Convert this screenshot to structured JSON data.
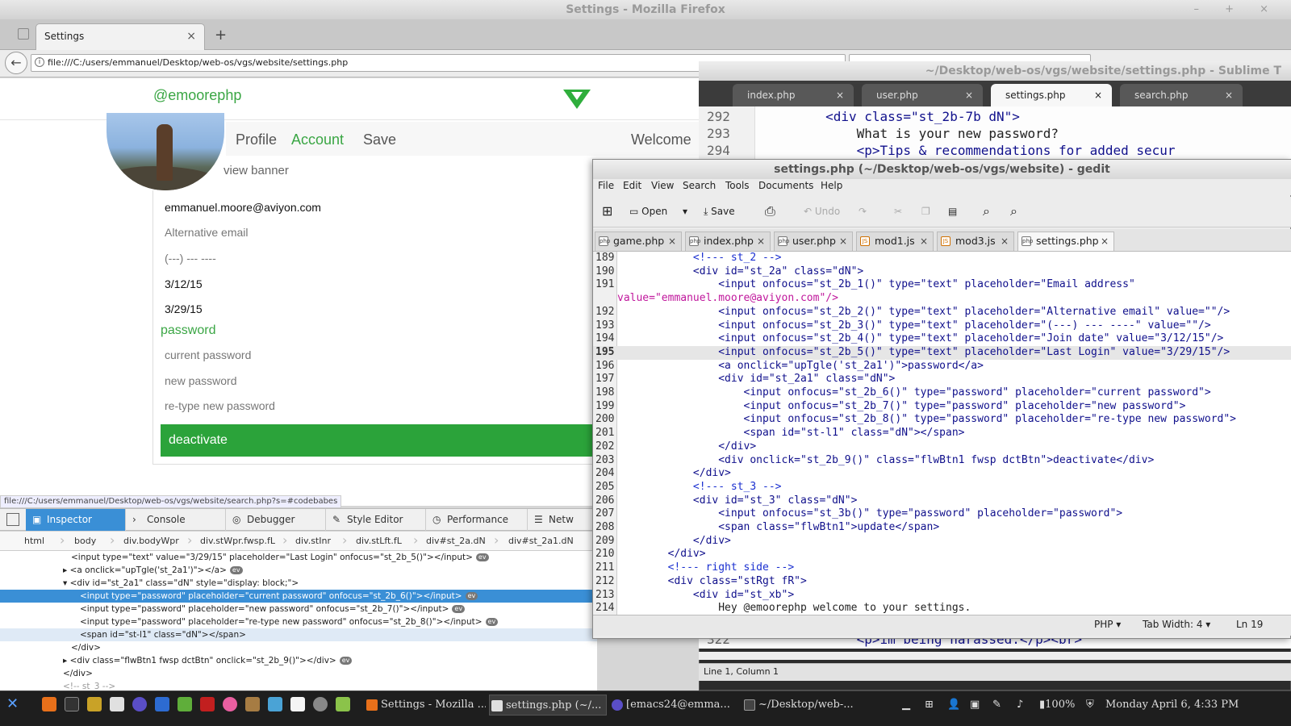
{
  "firefox": {
    "window_title": "Settings - Mozilla Firefox",
    "window_controls": "– + ×",
    "tab_label": "Settings",
    "tab_close": "×",
    "new_tab": "+",
    "back": "←",
    "url": "file:///C:/users/emmanuel/Desktop/web-os/vgs/website/settings.php",
    "status_url": "file:///C:/users/emmanuel/Desktop/web-os/vgs/website/search.php?s=#codebabes"
  },
  "site": {
    "handle": "@emoorephp",
    "brand_color": "#2fae3c",
    "nav": {
      "profile": "Profile",
      "account": "Account",
      "save": "Save",
      "welcome": "Welcome"
    },
    "view_banner": "view banner",
    "fields": {
      "email": "emmanuel.moore@aviyon.com",
      "alt_email": "Alternative email",
      "phone": "(---) --- ----",
      "join_date": "3/12/15",
      "last_login": "3/29/15"
    },
    "password_link": "password",
    "password_fields": {
      "current": "current password",
      "new": "new password",
      "retype": "re-type new password"
    },
    "deactivate": "deactivate"
  },
  "devtools": {
    "tabs": [
      "Inspector",
      "Console",
      "Debugger",
      "Style Editor",
      "Performance",
      "Netw"
    ],
    "breadcrumbs": [
      "html",
      "body",
      "div.bodyWpr",
      "div.stWpr.fwsp.fL",
      "div.stInr",
      "div.stLft.fL",
      "div#st_2a.dN",
      "div#st_2a1.dN"
    ],
    "ev_badge": "ev",
    "tree": [
      "<input type=\"text\" value=\"3/29/15\" placeholder=\"Last Login\" onfocus=\"st_2b_5()\"></input>",
      "<a onclick=\"upTgle('st_2a1')\"></a>",
      "<div id=\"st_2a1\" class=\"dN\" style=\"display: block;\">",
      "<input type=\"password\" placeholder=\"current password\" onfocus=\"st_2b_6()\"></input>",
      "<input type=\"password\" placeholder=\"new password\" onfocus=\"st_2b_7()\"></input>",
      "<input type=\"password\" placeholder=\"re-type new password\" onfocus=\"st_2b_8()\"></input>",
      "<span id=\"st-l1\" class=\"dN\"></span>",
      "</div>",
      "<div class=\"flwBtn1 fwsp dctBtn\" onclick=\"st_2b_9()\"></div>",
      "</div>",
      "<!-- st_3 -->"
    ]
  },
  "sublime": {
    "title": "~/Desktop/web-os/vgs/website/settings.php - Sublime T",
    "tabs": [
      "index.php",
      "user.php",
      "settings.php",
      "search.php"
    ],
    "active_tab": "settings.php",
    "tab_close": "×",
    "lines": [
      {
        "n": "292",
        "code": "        <div class=\"st_2b-7b dN\">"
      },
      {
        "n": "293",
        "code": "            What is your new password?"
      },
      {
        "n": "294",
        "code": "            <p>Tips & recommendations for added secur"
      }
    ],
    "lower_line": {
      "n": "322",
      "code": "            <p>im being harassed.</p><br>"
    },
    "status": "Line 1, Column 1"
  },
  "gedit": {
    "title": "settings.php (~/Desktop/web-os/vgs/website) - gedit",
    "menu": [
      "File",
      "Edit",
      "View",
      "Search",
      "Tools",
      "Documents",
      "Help"
    ],
    "toolbar": {
      "open": "Open",
      "save": "Save",
      "undo": "Undo"
    },
    "tabs": [
      {
        "label": "game.php",
        "type": "php"
      },
      {
        "label": "index.php",
        "type": "php"
      },
      {
        "label": "user.php",
        "type": "php"
      },
      {
        "label": "mod1.js",
        "type": "js"
      },
      {
        "label": "mod3.js",
        "type": "js"
      },
      {
        "label": "settings.php",
        "type": "php"
      }
    ],
    "tab_close": "×",
    "lines": [
      {
        "n": "189",
        "code": "            <!--- st_2 -->"
      },
      {
        "n": "190",
        "code": "            <div id=\"st_2a\" class=\"dN\">"
      },
      {
        "n": "191",
        "code": "                <input onfocus=\"st_2b_1()\" type=\"text\" placeholder=\"Email address\""
      },
      {
        "n": "",
        "code": "value=\"emmanuel.moore@aviyon.com\"/>"
      },
      {
        "n": "192",
        "code": "                <input onfocus=\"st_2b_2()\" type=\"text\" placeholder=\"Alternative email\" value=\"\"/>"
      },
      {
        "n": "193",
        "code": "                <input onfocus=\"st_2b_3()\" type=\"text\" placeholder=\"(---) --- ----\" value=\"\"/>"
      },
      {
        "n": "194",
        "code": "                <input onfocus=\"st_2b_4()\" type=\"text\" placeholder=\"Join date\" value=\"3/12/15\"/>"
      },
      {
        "n": "195",
        "code": "                <input onfocus=\"st_2b_5()\" type=\"text\" placeholder=\"Last Login\" value=\"3/29/15\"/>"
      },
      {
        "n": "196",
        "code": "                <a onclick=\"upTgle('st_2a1')\">password</a>"
      },
      {
        "n": "197",
        "code": "                <div id=\"st_2a1\" class=\"dN\">"
      },
      {
        "n": "198",
        "code": "                    <input onfocus=\"st_2b_6()\" type=\"password\" placeholder=\"current password\">"
      },
      {
        "n": "199",
        "code": "                    <input onfocus=\"st_2b_7()\" type=\"password\" placeholder=\"new password\">"
      },
      {
        "n": "200",
        "code": "                    <input onfocus=\"st_2b_8()\" type=\"password\" placeholder=\"re-type new password\">"
      },
      {
        "n": "201",
        "code": "                    <span id=\"st-l1\" class=\"dN\"></span>"
      },
      {
        "n": "202",
        "code": "                </div>"
      },
      {
        "n": "203",
        "code": "                <div onclick=\"st_2b_9()\" class=\"flwBtn1 fwsp dctBtn\">deactivate</div>"
      },
      {
        "n": "204",
        "code": "            </div>"
      },
      {
        "n": "205",
        "code": "            <!--- st_3 -->"
      },
      {
        "n": "206",
        "code": "            <div id=\"st_3\" class=\"dN\">"
      },
      {
        "n": "207",
        "code": "                <input onfocus=\"st_3b()\" type=\"password\" placeholder=\"password\">"
      },
      {
        "n": "208",
        "code": "                <span class=\"flwBtn1\">update</span>"
      },
      {
        "n": "209",
        "code": "            </div>"
      },
      {
        "n": "210",
        "code": "        </div>"
      },
      {
        "n": "211",
        "code": "        <!--- right side -->"
      },
      {
        "n": "212",
        "code": "        <div class=\"stRgt fR\">"
      },
      {
        "n": "213",
        "code": "            <div id=\"st_xb\">"
      },
      {
        "n": "214",
        "code": "                Hey @emoorephp welcome to your settings."
      }
    ],
    "current_line": "195",
    "status": {
      "lang": "PHP ▾",
      "tab_width": "Tab Width: 4 ▾",
      "position": "Ln 19"
    }
  },
  "taskbar": {
    "tasks": [
      {
        "label": "Settings - Mozilla ..."
      },
      {
        "label": "settings.php (~/..."
      },
      {
        "label": "[emacs24@emma..."
      },
      {
        "label": "~/Desktop/web-..."
      }
    ],
    "battery": "100%",
    "clock": "Monday April 6, 4:33 PM"
  }
}
